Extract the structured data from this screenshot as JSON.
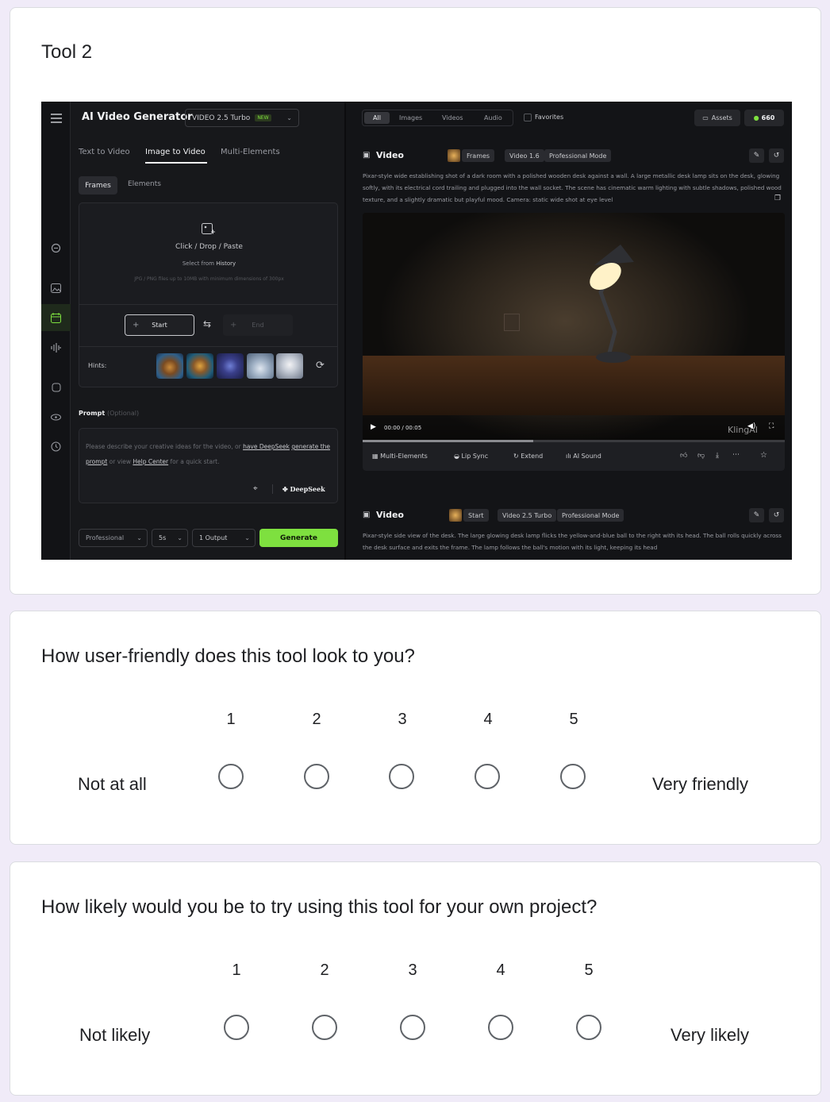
{
  "tool_card": {
    "title": "Tool 2"
  },
  "app": {
    "title": "AI Video Generator",
    "model_select": "VIDEO 2.5 Turbo",
    "model_badge": "NEW",
    "mode_tabs": [
      "Text to Video",
      "Image to Video",
      "Multi-Elements"
    ],
    "active_mode": "Image to Video",
    "sub_tabs": [
      "Frames",
      "Elements"
    ],
    "upload": {
      "primary": "Click / Drop / Paste",
      "select_prefix": "Select from",
      "select_link": "History",
      "requirements": "JPG / PNG files up to 10MB with minimum dimensions of 300px"
    },
    "start_label": "Start",
    "end_label": "End",
    "hints_label": "Hints:",
    "prompt": {
      "label": "Prompt",
      "optional": "(Optional)",
      "placeholder_a": "Please describe your creative ideas for the video, or",
      "link_a": "have DeepSeek",
      "link_b": "generate the prompt",
      "placeholder_b": "or view",
      "link_c": "Help Center",
      "placeholder_c": "for a quick start.",
      "deepseek_label": "DeepSeek"
    },
    "bottom_controls": {
      "quality": "Professional",
      "duration": "5s",
      "outputs": "1 Output",
      "generate": "Generate"
    },
    "filter_tabs": [
      "All",
      "Images",
      "Videos",
      "Audio"
    ],
    "active_filter": "All",
    "favorites": "Favorites",
    "assets": "Assets",
    "credits": "660",
    "result1": {
      "type": "Video",
      "tags": [
        "Frames",
        "Video 1.6",
        "Professional Mode"
      ],
      "description": "Pixar-style wide establishing shot of a dark room with a polished wooden desk against a wall. A large metallic desk lamp sits on the desk, glowing softly, with its electrical cord trailing and plugged into the wall socket. The scene has cinematic warm lighting with subtle shadows, polished wood texture, and a slightly dramatic but playful mood. Camera: static wide shot at eye level",
      "time": "00:00 / 00:05",
      "watermark": "KlingAI",
      "actions": [
        "Multi-Elements",
        "Lip Sync",
        "Extend",
        "AI Sound"
      ]
    },
    "result2": {
      "type": "Video",
      "tags": [
        "Start",
        "Video 2.5 Turbo",
        "Professional Mode"
      ],
      "description": "Pixar-style side view of the desk. The large glowing desk lamp flicks the yellow-and-blue ball to the right with its head. The ball rolls quickly across the desk surface and exits the frame. The lamp follows the ball's motion with its light, keeping its head"
    },
    "colors": {
      "accent": "#7ee03f",
      "background": "#141518"
    }
  },
  "q1": {
    "question": "How user-friendly does this tool look to you?",
    "scale": [
      "1",
      "2",
      "3",
      "4",
      "5"
    ],
    "low_label": "Not at all",
    "high_label": "Very friendly"
  },
  "q2": {
    "question": "How likely would you be to try using this tool for your own project?",
    "scale": [
      "1",
      "2",
      "3",
      "4",
      "5"
    ],
    "low_label": "Not likely",
    "high_label": "Very likely"
  }
}
